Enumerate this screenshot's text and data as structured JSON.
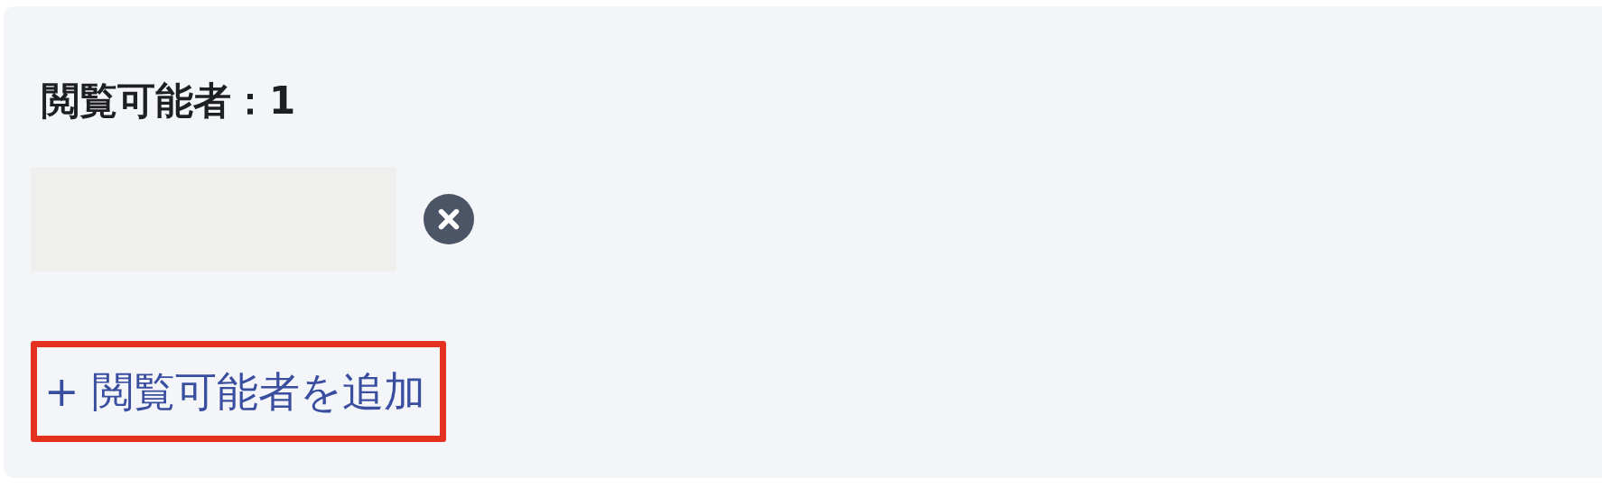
{
  "panel": {
    "title": "閲覧可能者：1",
    "viewers": [
      {
        "kind": "redacted",
        "removable": true
      }
    ],
    "add_button": {
      "label": "+ 閲覧可能者を追加",
      "highlighted": true
    }
  }
}
